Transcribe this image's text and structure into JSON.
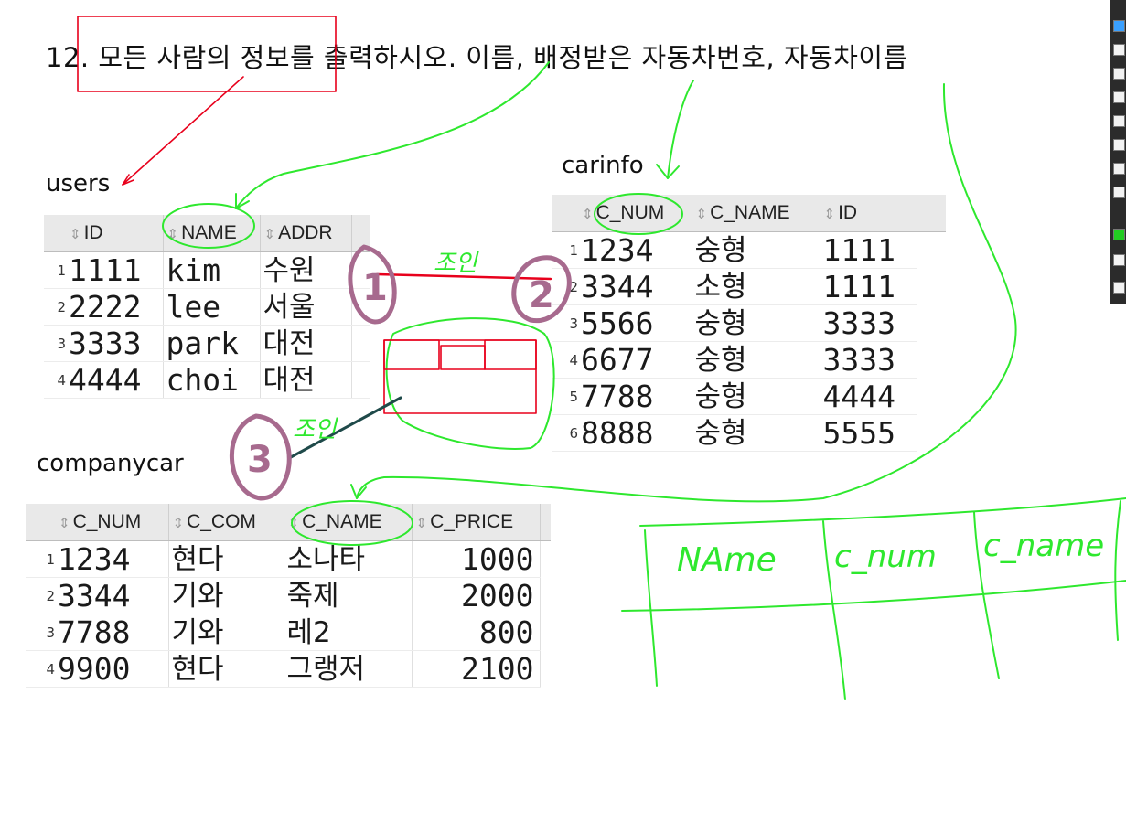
{
  "question": "12. 모든 사람의 정보를 출력하시오. 이름, 배정받은 자동차번호, 자동차이름",
  "users": {
    "title": "users",
    "columns": [
      "ID",
      "NAME",
      "ADDR"
    ],
    "rows": [
      {
        "n": "1",
        "id": "1111",
        "name": "kim",
        "addr": "수원"
      },
      {
        "n": "2",
        "id": "2222",
        "name": "lee",
        "addr": "서울"
      },
      {
        "n": "3",
        "id": "3333",
        "name": "park",
        "addr": "대전"
      },
      {
        "n": "4",
        "id": "4444",
        "name": "choi",
        "addr": "대전"
      }
    ]
  },
  "carinfo": {
    "title": "carinfo",
    "columns": [
      "C_NUM",
      "C_NAME",
      "ID"
    ],
    "rows": [
      {
        "n": "1",
        "c_num": "1234",
        "c_name": "숭형",
        "id": "1111"
      },
      {
        "n": "2",
        "c_num": "3344",
        "c_name": "소형",
        "id": "1111"
      },
      {
        "n": "3",
        "c_num": "5566",
        "c_name": "숭형",
        "id": "3333"
      },
      {
        "n": "4",
        "c_num": "6677",
        "c_name": "숭형",
        "id": "3333"
      },
      {
        "n": "5",
        "c_num": "7788",
        "c_name": "숭형",
        "id": "4444"
      },
      {
        "n": "6",
        "c_num": "8888",
        "c_name": "숭형",
        "id": "5555"
      }
    ]
  },
  "companycar": {
    "title": "companycar",
    "columns": [
      "C_NUM",
      "C_COM",
      "C_NAME",
      "C_PRICE"
    ],
    "rows": [
      {
        "n": "1",
        "c_num": "1234",
        "c_com": "현다",
        "c_name": "소나타",
        "c_price": "1000"
      },
      {
        "n": "2",
        "c_num": "3344",
        "c_com": "기와",
        "c_name": "죽제",
        "c_price": "2000"
      },
      {
        "n": "3",
        "c_num": "7788",
        "c_com": "기와",
        "c_name": "레2",
        "c_price": "800"
      },
      {
        "n": "4",
        "c_num": "9900",
        "c_com": "현다",
        "c_name": "그랭저",
        "c_price": "2100"
      }
    ]
  },
  "annotations": {
    "circle_1": "1",
    "circle_2": "2",
    "circle_3": "3",
    "join_label_a": "조인",
    "join_label_b": "조인",
    "result_headers": [
      "NAme",
      "c_num",
      "c_name"
    ]
  },
  "colors": {
    "red_ink": "#e8001c",
    "green_ink": "#2ee82e",
    "purple_ink": "#a76a8e",
    "dark_line": "#1f4a4a",
    "header_bg": "#e9e9e9"
  }
}
